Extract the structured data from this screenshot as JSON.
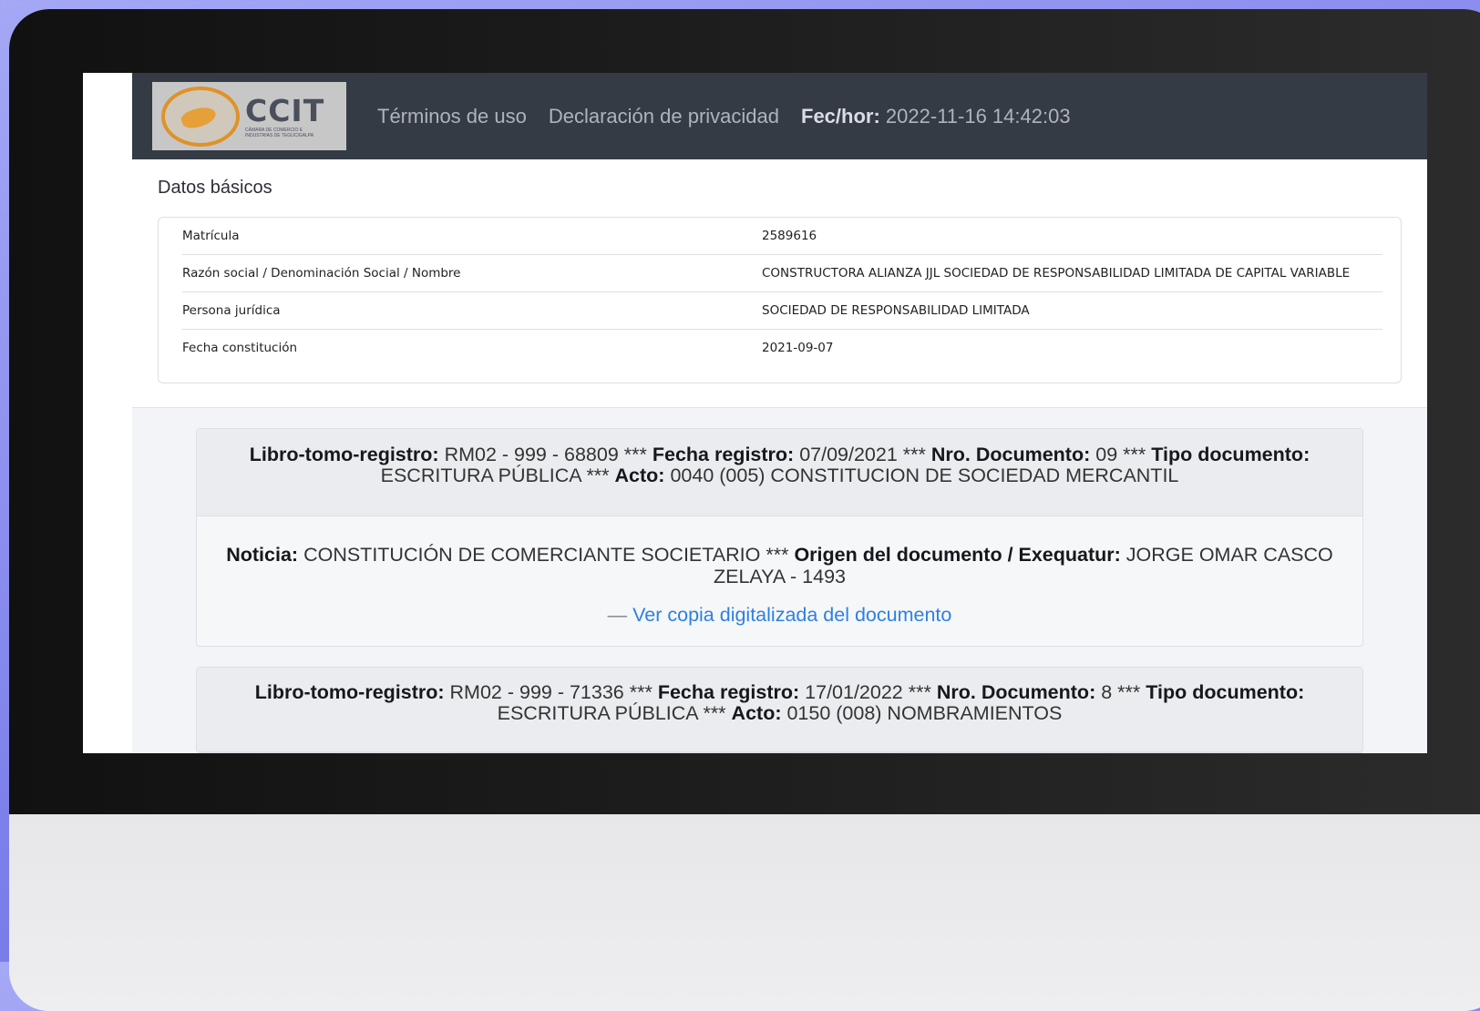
{
  "header": {
    "logo_text": "CCIT",
    "logo_subtext": "CÁMARA DE COMERCIO E INDUSTRIAS DE TEGUCIGALPA",
    "nav_terms": "Términos de uso",
    "nav_privacy": "Declaración de privacidad",
    "datetime_label": "Fec/hor:",
    "datetime_value": "2022-11-16 14:42:03"
  },
  "datos_basicos": {
    "title": "Datos básicos",
    "rows": [
      {
        "label": "Matrícula",
        "value": "2589616"
      },
      {
        "label": "Razón social / Denominación Social / Nombre",
        "value": "CONSTRUCTORA ALIANZA JJL SOCIEDAD DE RESPONSABILIDAD LIMITADA DE CAPITAL VARIABLE"
      },
      {
        "label": "Persona jurídica",
        "value": "SOCIEDAD DE RESPONSABILIDAD LIMITADA"
      },
      {
        "label": "Fecha constitución",
        "value": "2021-09-07"
      }
    ]
  },
  "labels": {
    "libro": "Libro-tomo-registro:",
    "fecha_registro": "Fecha registro:",
    "nro_documento": "Nro. Documento:",
    "tipo_documento": "Tipo documento:",
    "acto": "Acto:",
    "noticia": "Noticia:",
    "origen": "Origen del documento / Exequatur:",
    "sep": "***"
  },
  "registros": [
    {
      "libro": "RM02 - 999 - 68809",
      "fecha_registro": "07/09/2021",
      "nro_documento": "09",
      "tipo_documento": "ESCRITURA PÚBLICA",
      "acto": "0040 (005) CONSTITUCION DE SOCIEDAD MERCANTIL",
      "noticia": "CONSTITUCIÓN DE COMERCIANTE SOCIETARIO",
      "origen": "JORGE OMAR CASCO ZELAYA - 1493",
      "link_dash": "—",
      "link_text": "Ver copia digitalizada del documento"
    },
    {
      "libro": "RM02 - 999 - 71336",
      "fecha_registro": "17/01/2022",
      "nro_documento": "8",
      "tipo_documento": "ESCRITURA PÚBLICA",
      "acto": "0150 (008) NOMBRAMIENTOS"
    }
  ]
}
